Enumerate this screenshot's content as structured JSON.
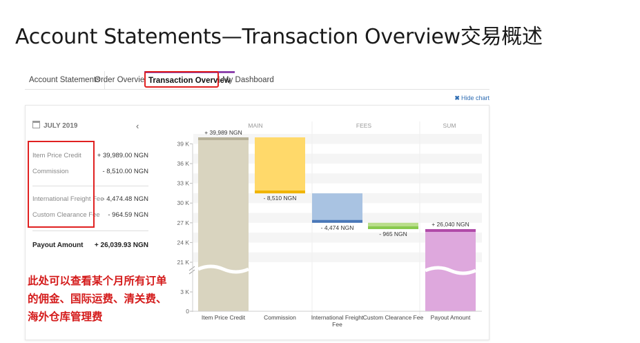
{
  "slide": {
    "title": "Account Statements—Transaction Overview交易概述"
  },
  "tabs": [
    {
      "label": "Account Statements"
    },
    {
      "label": "Order Overview"
    },
    {
      "label": "Transaction Overview",
      "active": true
    },
    {
      "label": "My Dashboard"
    }
  ],
  "toolbar": {
    "hide_chart": "Hide chart"
  },
  "summary": {
    "month": "JULY 2019",
    "items": [
      {
        "label": "Item Price Credit",
        "value": "+ 39,989.00 NGN"
      },
      {
        "label": "Commission",
        "value": "- 8,510.00 NGN"
      },
      {
        "label": "International Freight Fee",
        "value": "- 4,474.48 NGN"
      },
      {
        "label": "Custom Clearance Fee",
        "value": "- 964.59 NGN"
      }
    ],
    "payout": {
      "label": "Payout Amount",
      "value": "+ 26,039.93 NGN"
    }
  },
  "annotation": {
    "lines": [
      "此处可以查看某个月所有订单",
      "的佣金、国际运费、清关费、",
      "海外仓库管理费"
    ]
  },
  "colors": {
    "accent": "#8e44ad",
    "highlight": "#e02020",
    "item_price": "#d9d4bf",
    "commission": "#ffd96a",
    "freight": "#a9c3e2",
    "clearance": "#b9dd8a",
    "payout": "#dea8dd"
  },
  "chart_data": {
    "type": "bar",
    "subtype": "waterfall",
    "groups": [
      "MAIN",
      "FEES",
      "SUM"
    ],
    "categories": [
      "Item Price Credit",
      "Commission",
      "International Freight Fee",
      "Custom Clearance Fee",
      "Payout Amount"
    ],
    "values": [
      39989,
      -8510,
      -4474,
      -965,
      26040
    ],
    "data_labels": [
      "+ 39,989 NGN",
      "- 8,510 NGN",
      "- 4,474 NGN",
      "- 965 NGN",
      "+ 26,040 NGN"
    ],
    "y_ticks": [
      "0",
      "3 K",
      "21 K",
      "24 K",
      "27 K",
      "30 K",
      "33 K",
      "36 K",
      "39 K"
    ],
    "y_axis_break": [
      3000,
      21000
    ],
    "ylim": [
      0,
      40500
    ]
  }
}
